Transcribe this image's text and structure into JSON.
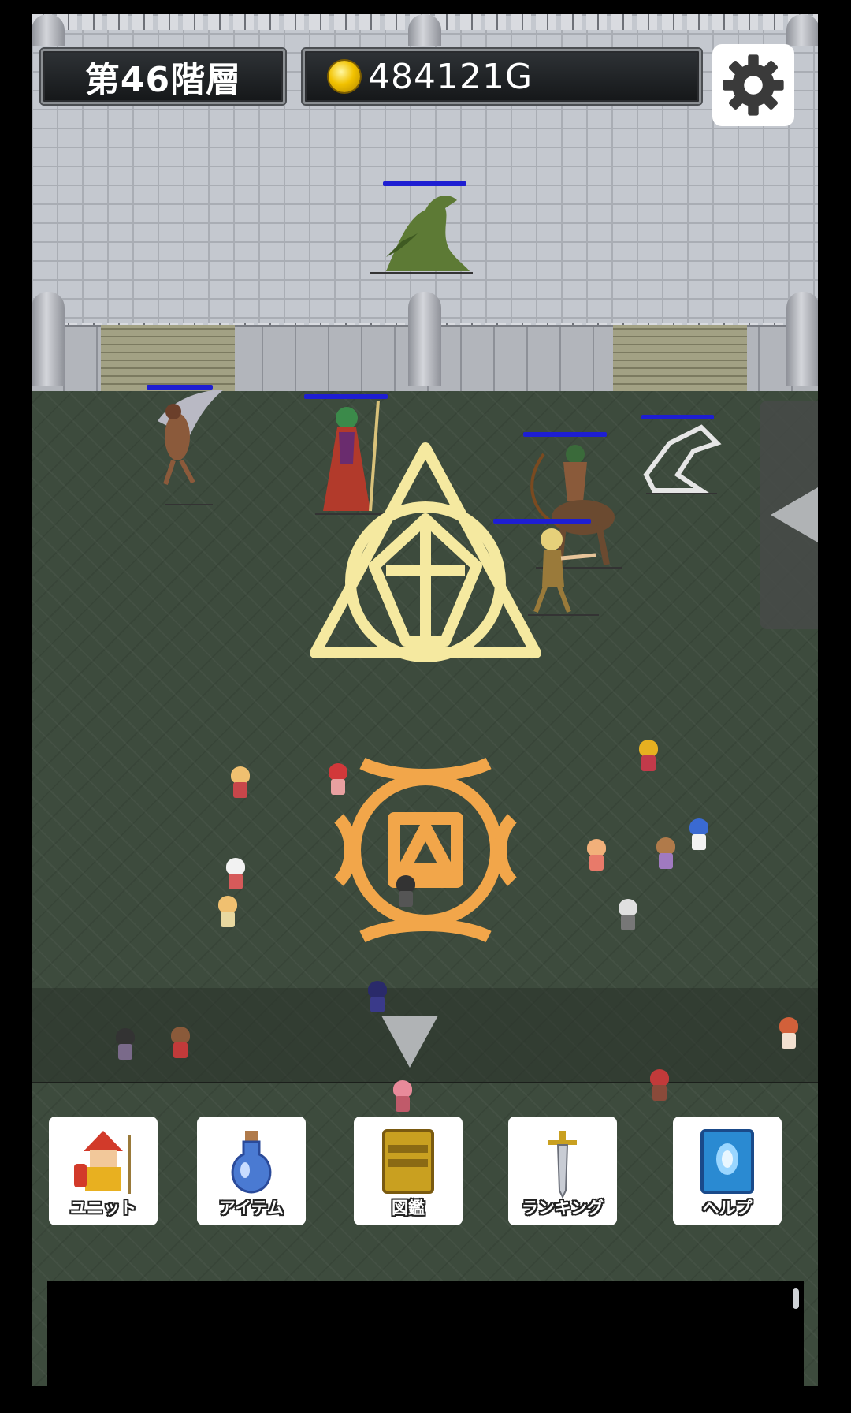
{
  "header": {
    "floor_label": "第46階層",
    "gold_value": "484121G"
  },
  "icons": {
    "settings": "gear-icon",
    "coin": "gold-coin-icon",
    "collapse": "triangle-left-icon",
    "expand": "triangle-down-icon"
  },
  "menu": [
    {
      "label": "ユニット",
      "icon": "warrior-icon"
    },
    {
      "label": "アイテム",
      "icon": "potion-icon"
    },
    {
      "label": "図鑑",
      "icon": "book-icon"
    },
    {
      "label": "ランキング",
      "icon": "sword-icon"
    },
    {
      "label": "ヘルプ",
      "icon": "help-book-icon"
    }
  ],
  "colors": {
    "hp_bar": "#1e1ed2",
    "magic_circle_enemy": "#f5e9a0",
    "magic_circle_ally": "#f2a64a"
  }
}
